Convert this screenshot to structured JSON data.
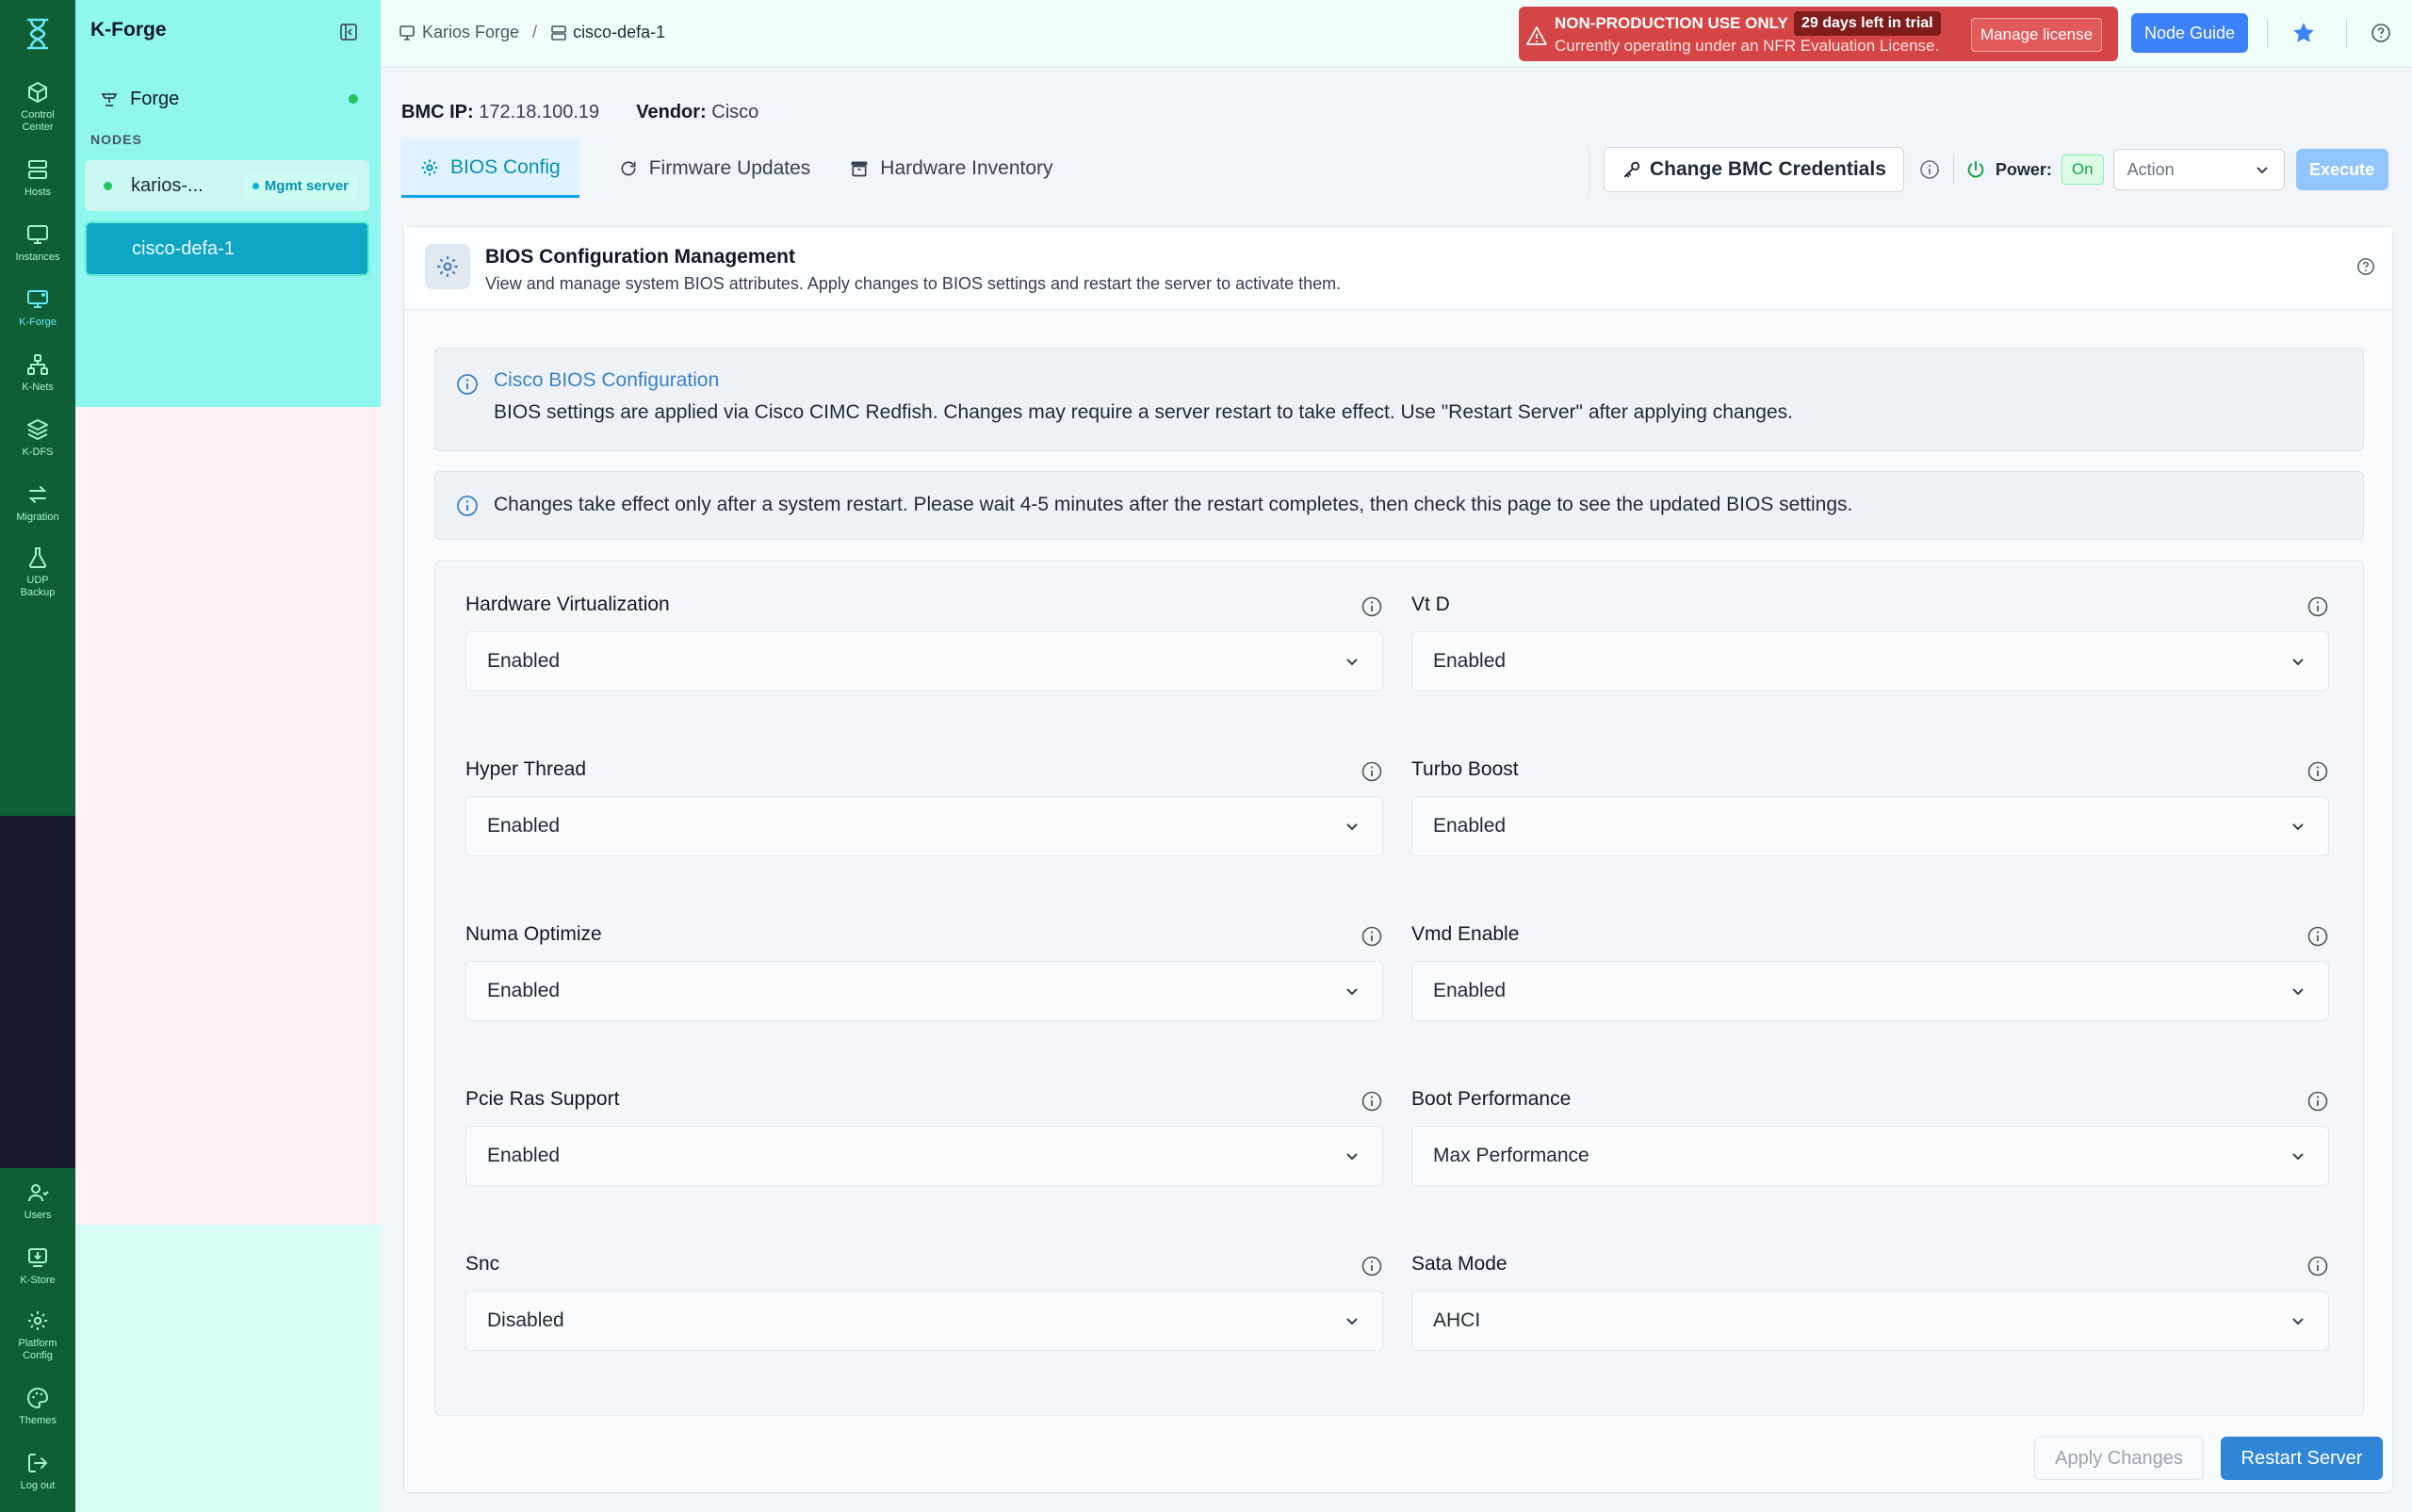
{
  "rail": {
    "items": [
      {
        "label": "Control\nCenter",
        "icon": "cube-icon"
      },
      {
        "label": "Hosts",
        "icon": "server-icon"
      },
      {
        "label": "Instances",
        "icon": "monitor-icon"
      },
      {
        "label": "K-Forge",
        "icon": "forge-icon"
      },
      {
        "label": "K-Nets",
        "icon": "network-icon"
      },
      {
        "label": "K-DFS",
        "icon": "layers-icon"
      },
      {
        "label": "Migration",
        "icon": "arrows-icon"
      },
      {
        "label": "UDP\nBackup",
        "icon": "flask-icon"
      },
      {
        "label": "Users",
        "icon": "users-icon"
      },
      {
        "label": "K-Store",
        "icon": "download-icon"
      },
      {
        "label": "Platform\nConfig",
        "icon": "gear-icon"
      },
      {
        "label": "Themes",
        "icon": "palette-icon"
      },
      {
        "label": "Log out",
        "icon": "logout-icon"
      }
    ],
    "rail_0": "Control",
    "rail_0b": "Center",
    "rail_1": "Hosts",
    "rail_2": "Instances",
    "rail_3": "K-Forge",
    "rail_4": "K-Nets",
    "rail_5": "K-DFS",
    "rail_6": "Migration",
    "rail_7": "UDP",
    "rail_7b": "Backup",
    "rail_8": "Users",
    "rail_9": "K-Store",
    "rail_10": "Platform",
    "rail_10b": "Config",
    "rail_11": "Themes",
    "rail_12": "Log out"
  },
  "sidebar": {
    "title": "K-Forge",
    "forge_label": "Forge",
    "nodes_label": "NODES",
    "nodes": [
      {
        "name": "karios-...",
        "badge": "Mgmt server"
      },
      {
        "name": "cisco-defa-1"
      }
    ]
  },
  "topbar": {
    "breadcrumb_root": "Karios Forge",
    "breadcrumb_sep": "/",
    "breadcrumb_current": "cisco-defa-1",
    "warning_title": "NON-PRODUCTION USE ONLY",
    "warning_trial": "29 days left in trial",
    "warning_body": "Currently operating under an NFR Evaluation License.",
    "manage_license": "Manage license",
    "node_guide": "Node Guide"
  },
  "server": {
    "bmc_ip_label": "BMC IP:",
    "bmc_ip": "172.18.100.19",
    "vendor_label": "Vendor:",
    "vendor": "Cisco"
  },
  "tabs": [
    {
      "label": "BIOS Config"
    },
    {
      "label": "Firmware Updates"
    },
    {
      "label": "Hardware Inventory"
    }
  ],
  "actions": {
    "change_bmc": "Change BMC Credentials",
    "power_label": "Power:",
    "power_state": "On",
    "action_placeholder": "Action",
    "execute": "Execute"
  },
  "card": {
    "title": "BIOS Configuration Management",
    "subtitle": "View and manage system BIOS attributes. Apply changes to BIOS settings and restart the server to activate them."
  },
  "alerts": {
    "cisco_title": "Cisco BIOS Configuration",
    "cisco_body": "BIOS settings are applied via Cisco CIMC Redfish. Changes may require a server restart to take effect. Use \"Restart Server\" after applying changes.",
    "restart_note": "Changes take effect only after a system restart. Please wait 4-5 minutes after the restart completes, then check this page to see the updated BIOS settings."
  },
  "settings": [
    {
      "label": "Hardware Virtualization",
      "value": "Enabled"
    },
    {
      "label": "Vt D",
      "value": "Enabled"
    },
    {
      "label": "Hyper Thread",
      "value": "Enabled"
    },
    {
      "label": "Turbo Boost",
      "value": "Enabled"
    },
    {
      "label": "Numa Optimize",
      "value": "Enabled"
    },
    {
      "label": "Vmd Enable",
      "value": "Enabled"
    },
    {
      "label": "Pcie Ras Support",
      "value": "Enabled"
    },
    {
      "label": "Boot Performance",
      "value": "Max Performance"
    },
    {
      "label": "Snc",
      "value": "Disabled"
    },
    {
      "label": "Sata Mode",
      "value": "AHCI"
    }
  ],
  "footer": {
    "apply": "Apply Changes",
    "restart": "Restart Server"
  },
  "colors": {
    "rail": "#0f5e35",
    "accent": "#0ea5c4",
    "primary_button": "#2f86d6",
    "warning": "#d64545"
  }
}
